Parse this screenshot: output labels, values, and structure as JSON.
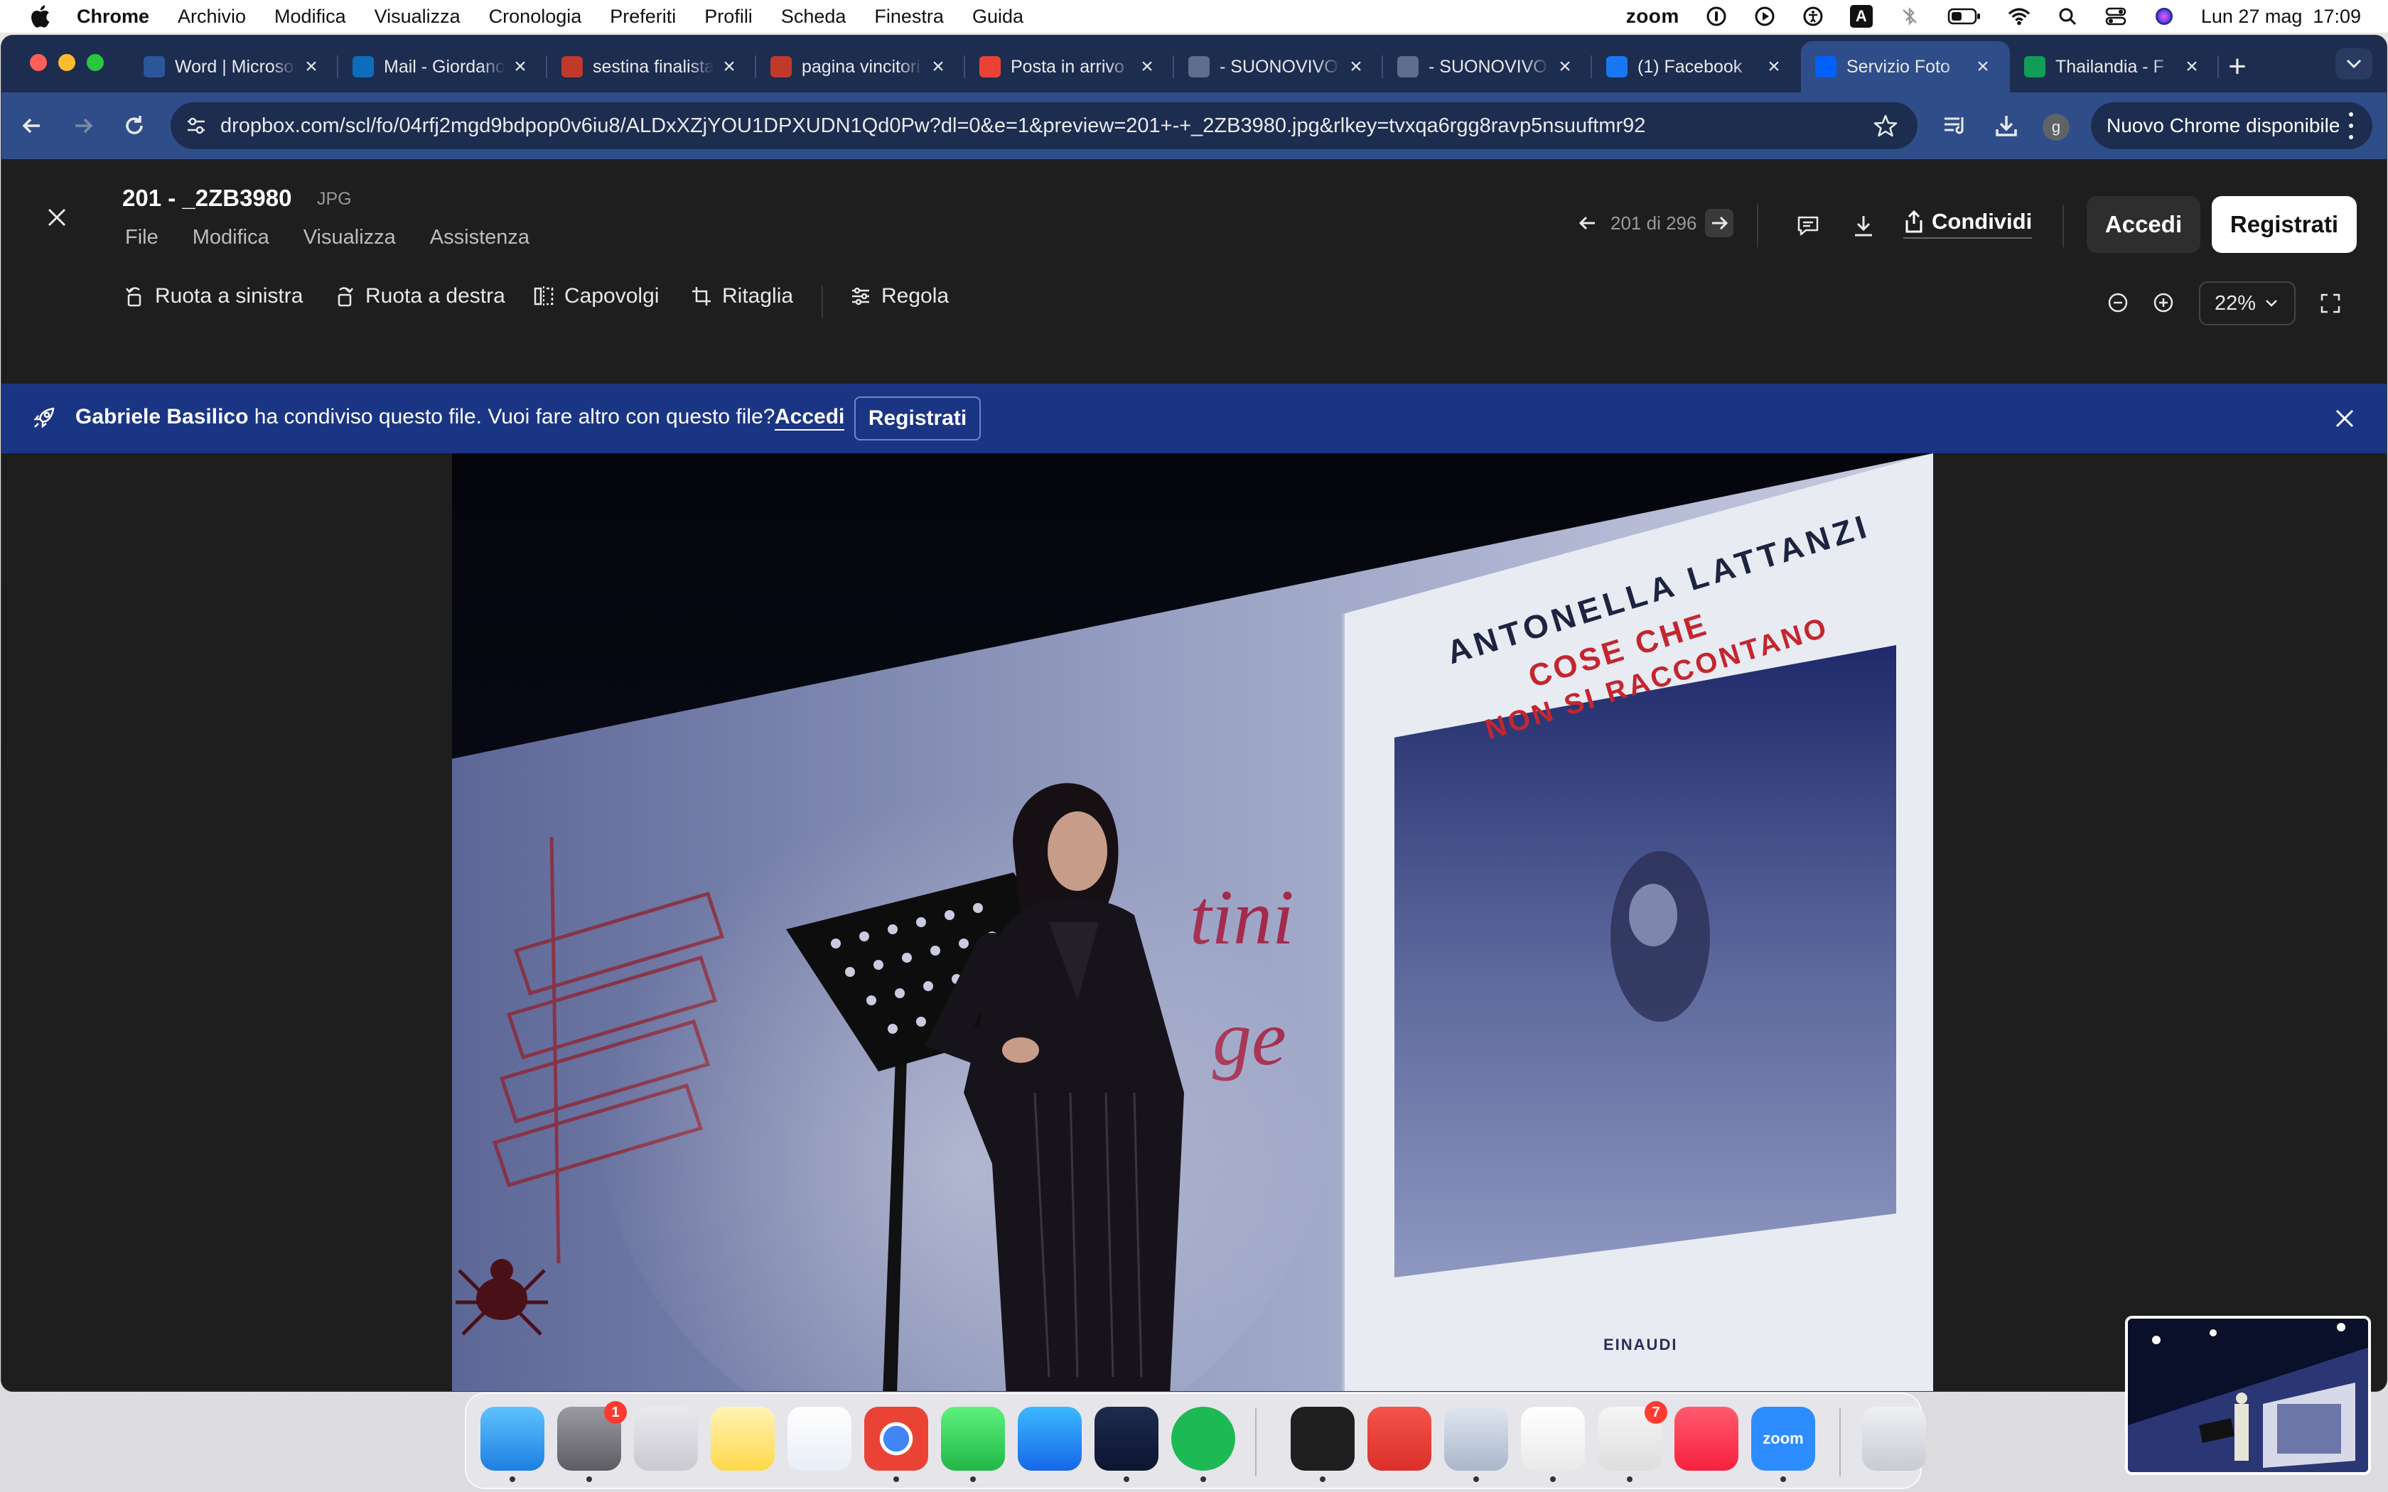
{
  "menubar": {
    "items": [
      "Chrome",
      "Archivio",
      "Modifica",
      "Visualizza",
      "Cronologia",
      "Preferiti",
      "Profili",
      "Scheda",
      "Finestra",
      "Guida"
    ],
    "zoom_label": "zoom",
    "input_indicator": "A",
    "datetime": "Lun 27 mag  17:09"
  },
  "browser": {
    "tabs": [
      {
        "title": "Word | Microsoft",
        "color": "#2b579a"
      },
      {
        "title": "Mail - Giordano",
        "color": "#0f6cbd"
      },
      {
        "title": "sestina finalista",
        "color": "#c0392b"
      },
      {
        "title": "pagina vincitori",
        "color": "#c0392b"
      },
      {
        "title": "Posta in arrivo",
        "color": "#ea4335"
      },
      {
        "title": "- SUONOVIVO",
        "color": "#5f6d8c"
      },
      {
        "title": "- SUONOVIVO",
        "color": "#5f6d8c"
      },
      {
        "title": "(1) Facebook",
        "color": "#1877f2"
      },
      {
        "title": "Servizio Foto",
        "color": "#0061fe"
      },
      {
        "title": "Thailandia - F",
        "color": "#0f9d58"
      }
    ],
    "url": "dropbox.com/scl/fo/04rfj2mgd9bdpop0v6iu8/ALDxXZjYOU1DPXUDN1Qd0Pw?dl=0&e=1&preview=201+-+_2ZB3980.jpg&rlkey=tvxqa6rgg8ravp5nsuuftmr92",
    "profile_initial": "g",
    "update_label": "Nuovo Chrome disponibile"
  },
  "viewer": {
    "file_name": "201 - _2ZB3980",
    "file_type": "JPG",
    "menu": [
      "File",
      "Modifica",
      "Visualizza",
      "Assistenza"
    ],
    "pager": "201 di 296",
    "share_label": "Condividi",
    "login_label": "Accedi",
    "signup_label": "Registrati",
    "tools": {
      "rotate_left": "Ruota a sinistra",
      "rotate_right": "Ruota a destra",
      "flip": "Capovolgi",
      "crop": "Ritaglia",
      "adjust": "Regola"
    },
    "zoom_level": "22%"
  },
  "banner": {
    "sharer": "Gabriele Basilico",
    "message": " ha condiviso questo file. Vuoi fare altro con questo file?",
    "login_link": "Accedi",
    "signup_button": "Registrati"
  },
  "photo": {
    "book_author": "ANTONELLA LATTANZI",
    "book_title_1": "COSE CHE",
    "book_title_2": "NON SI RACCONTANO",
    "publisher": "EINAUDI",
    "backdrop_text_1": "tini",
    "backdrop_text_2": "ge"
  },
  "dock": {
    "apps": [
      "Finder",
      "Impostazioni di Sistema",
      "Launchpad",
      "Note",
      "Freeform",
      "Google Chrome",
      "WhatsApp",
      "App Store",
      "Steam",
      "Spotify",
      "Terminale",
      "AnyDesk",
      "Anteprima",
      "TextEdit",
      "Microsoft Office",
      "Musica",
      "Zoom",
      "Cestino"
    ],
    "badges": {
      "settings": "1",
      "office": "7"
    },
    "zoom_label": "zoom"
  }
}
